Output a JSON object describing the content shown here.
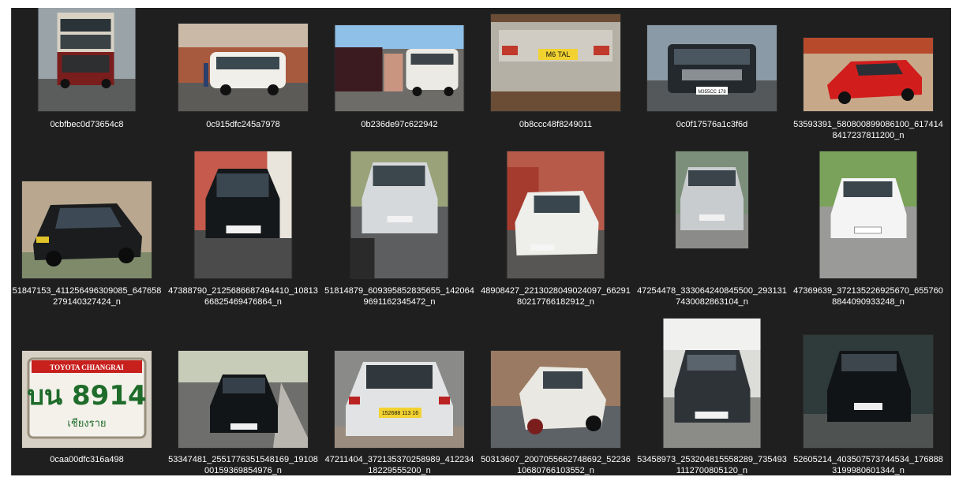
{
  "files": [
    "0cbfbec0d73654c8",
    "0c915dfc245a7978",
    "0b236de97c622942",
    "0b8ccc48f8249011",
    "0c0f17576a1c3f6d",
    "53593391_580800899086100_6174148417237811200_n",
    "51847153_411256496309085_647658279140327424_n",
    "47388790_2125686687494410_1081366825469476864_n",
    "51814879_609395852835655_1420649691162345472_n",
    "48908427_2213028049024097_6629180217766182912_n",
    "47254478_333064240845500_2931317430082863104_n",
    "47369639_372135226925670_6557608844090933248_n",
    "0caa00dfc316a498",
    "53347481_2551776351548169_1910800159369854976_n",
    "47211404_372135370258989_41223418229555200_n",
    "50313607_2007055662748692_5223610680766103552_n",
    "53458973_253204815558289_7354931112700805120_n",
    "52605214_403507573744534_1768883199980601344_n"
  ],
  "plates": {
    "f3": "M6 TAL",
    "f4": "M355CC 178",
    "f12_line1": "บน 8914",
    "f12_line2": "เชียงราย",
    "f12_dealer": "TOYOTA CHIANGRAI",
    "f14": "152688 113 16"
  },
  "colors": {
    "viewer_bg": "#1f1f1f",
    "caption_text": "#ffffff"
  }
}
